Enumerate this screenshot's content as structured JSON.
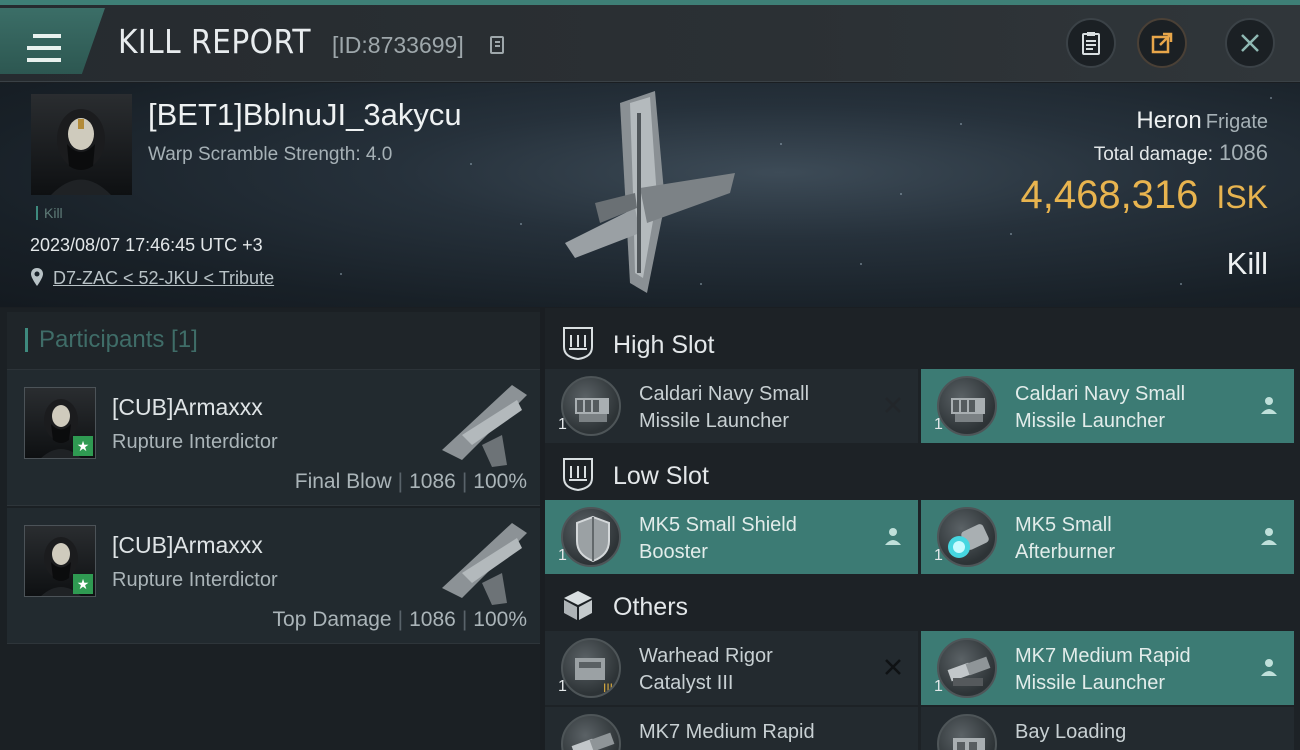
{
  "header": {
    "title": "KILL REPORT",
    "report_id": "[ID:8733699]"
  },
  "victim": {
    "pilot": "[BET1]BblnuJI_3akycu",
    "warp_scramble": "Warp Scramble Strength: 4.0",
    "kill_tag": "Kill",
    "datetime": "2023/08/07 17:46:45 UTC +3",
    "location": "D7-ZAC < 52-JKU < Tribute",
    "ship_name": "Heron",
    "ship_class": "Frigate",
    "total_damage_label": "Total damage:",
    "total_damage": "1086",
    "isk_value": "4,468,316",
    "isk_unit": "ISK",
    "kill_type": "Kill"
  },
  "participants": {
    "title": "Participants [1]",
    "rows": [
      {
        "name": "[CUB]Armaxxx",
        "ship": "Rupture Interdictor",
        "role": "Final Blow",
        "damage": "1086",
        "percent": "100%"
      },
      {
        "name": "[CUB]Armaxxx",
        "ship": "Rupture Interdictor",
        "role": "Top Damage",
        "damage": "1086",
        "percent": "100%"
      }
    ]
  },
  "fittings": {
    "high_slot": {
      "label": "High Slot",
      "modules": [
        {
          "name_line1": "Caldari Navy Small",
          "name_line2": "Missile Launcher",
          "qty": "1",
          "state": "destroyed"
        },
        {
          "name_line1": "Caldari Navy Small",
          "name_line2": "Missile Launcher",
          "qty": "1",
          "state": "dropped"
        }
      ]
    },
    "low_slot": {
      "label": "Low Slot",
      "modules": [
        {
          "name_line1": "MK5 Small Shield",
          "name_line2": "Booster",
          "qty": "1",
          "state": "dropped"
        },
        {
          "name_line1": "MK5 Small",
          "name_line2": "Afterburner",
          "qty": "1",
          "state": "dropped"
        }
      ]
    },
    "others": {
      "label": "Others",
      "modules": [
        {
          "name_line1": "Warhead Rigor",
          "name_line2": "Catalyst III",
          "qty": "1",
          "state": "destroyed"
        },
        {
          "name_line1": "MK7 Medium Rapid",
          "name_line2": "Missile Launcher",
          "qty": "1",
          "state": "dropped"
        },
        {
          "name_line1": "MK7 Medium Rapid",
          "name_line2": "",
          "qty": "",
          "state": "destroyed"
        },
        {
          "name_line1": "Bay Loading",
          "name_line2": "",
          "qty": "",
          "state": "destroyed"
        }
      ]
    }
  },
  "colors": {
    "accent_teal": "#3c7b74",
    "isk_gold": "#e8b44f",
    "corp_star_green": "#2f9a52"
  }
}
